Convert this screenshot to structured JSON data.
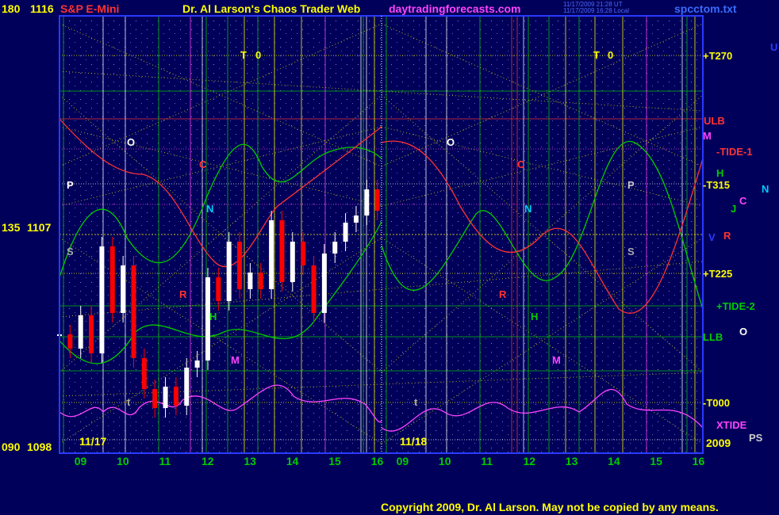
{
  "header": {
    "left_price": "180  1116",
    "symbol": "S&P E-Mini",
    "site_title": "Dr. Al Larson's Chaos Trader Web",
    "site_url": "daytradingforecasts.com",
    "stamp_1": "11/17/2009 21:28 UT",
    "stamp_2": "11/17/2009 16:28 Local",
    "filename": "spcctom.txt"
  },
  "footer": {
    "copyright": "Copyright 2009, Dr. Al Larson. May not be copied by any means."
  },
  "colors": {
    "background": "#00005a",
    "frame": "#ffff00",
    "price_up": "#ffffff",
    "price_down": "#ff0000",
    "channel": "#00cc00",
    "cycle": "#ff3333",
    "xtide": "#ff44ff",
    "grid_diag": "#d8d800"
  },
  "chart_data": {
    "type": "line",
    "title": "S&P E-Mini",
    "y_axis": {
      "labels": [
        {
          "angle": "180",
          "price": "1116"
        },
        {
          "angle": "135",
          "price": "1107"
        },
        {
          "angle": "090",
          "price": "1098"
        }
      ],
      "ylim": [
        1098,
        1116
      ]
    },
    "x_axis": {
      "date_left": "11/17",
      "date_right": "11/18",
      "year": "2009",
      "hour_ticks_left": [
        "09",
        "10",
        "11",
        "12",
        "13",
        "14",
        "15",
        "16"
      ],
      "hour_ticks_right": [
        "09",
        "10",
        "11",
        "12",
        "13",
        "14",
        "15",
        "16"
      ]
    },
    "right_labels": [
      "+T270",
      "ULB",
      "M",
      "-TIDE-1",
      "H",
      "N",
      "-T315",
      "C",
      "J",
      "V",
      "R",
      "U",
      "+T225",
      "+TIDE-2",
      "O",
      "LLB",
      "-T000",
      "XTIDE",
      "PS"
    ],
    "markers": [
      {
        "text": "T",
        "panel": "left"
      },
      {
        "text": "0",
        "panel": "left"
      },
      {
        "text": "O",
        "panel": "left"
      },
      {
        "text": "P",
        "panel": "left"
      },
      {
        "text": "S",
        "panel": "left"
      },
      {
        "text": "t",
        "panel": "left"
      },
      {
        "text": "C",
        "panel": "left"
      },
      {
        "text": "N",
        "panel": "left"
      },
      {
        "text": "R",
        "panel": "left"
      },
      {
        "text": "H",
        "panel": "left"
      },
      {
        "text": "M",
        "panel": "left"
      },
      {
        "text": "T",
        "panel": "right"
      },
      {
        "text": "0",
        "panel": "right"
      },
      {
        "text": "O",
        "panel": "right"
      },
      {
        "text": "P",
        "panel": "right"
      },
      {
        "text": "S",
        "panel": "right"
      },
      {
        "text": "t",
        "panel": "right"
      },
      {
        "text": "C",
        "panel": "right"
      },
      {
        "text": "N",
        "panel": "right"
      },
      {
        "text": "R",
        "panel": "right"
      },
      {
        "text": "H",
        "panel": "right"
      },
      {
        "text": "M",
        "panel": "right"
      }
    ],
    "price_series": {
      "name": "S&P E-Mini",
      "x_hours": [
        8.5,
        8.75,
        9,
        9.25,
        9.5,
        9.75,
        10,
        10.25,
        10.5,
        10.75,
        11,
        11.25,
        11.5,
        11.75,
        12,
        12.25,
        12.5,
        12.75,
        13,
        13.25,
        13.5,
        13.75,
        14,
        14.25,
        14.5,
        14.75,
        15,
        15.25,
        15.5,
        15.75,
        16
      ],
      "close": [
        1102.6,
        1102.0,
        1103.4,
        1101.8,
        1106.3,
        1103.5,
        1105.5,
        1101.6,
        1100.3,
        1099.5,
        1100.4,
        1099.6,
        1101.2,
        1101.5,
        1105.0,
        1104.0,
        1106.5,
        1104.5,
        1105.2,
        1104.5,
        1107.4,
        1104.8,
        1106.5,
        1105.5,
        1103.5,
        1106.0,
        1106.5,
        1107.3,
        1107.6,
        1108.7,
        1107.8
      ]
    }
  }
}
